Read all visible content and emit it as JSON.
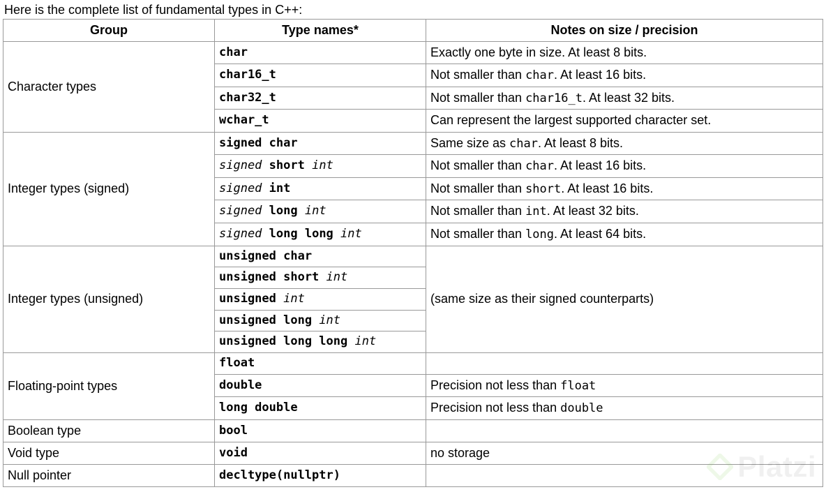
{
  "intro": "Here is the complete list of fundamental types in C++:",
  "headers": {
    "group": "Group",
    "type": "Type names*",
    "notes": "Notes on size / precision"
  },
  "watermark": "Platzi",
  "groups": [
    {
      "name": "Character types",
      "rows": [
        {
          "type_parts": [
            {
              "t": "char",
              "b": true
            }
          ],
          "notes_parts": [
            {
              "t": "Exactly one byte in size. At least 8 bits."
            }
          ]
        },
        {
          "type_parts": [
            {
              "t": "char16_t",
              "b": true
            }
          ],
          "notes_parts": [
            {
              "t": "Not smaller than "
            },
            {
              "t": "char",
              "mono": true
            },
            {
              "t": ". At least 16 bits."
            }
          ]
        },
        {
          "type_parts": [
            {
              "t": "char32_t",
              "b": true
            }
          ],
          "notes_parts": [
            {
              "t": "Not smaller than "
            },
            {
              "t": "char16_t",
              "mono": true
            },
            {
              "t": ". At least 32 bits."
            }
          ]
        },
        {
          "type_parts": [
            {
              "t": "wchar_t",
              "b": true
            }
          ],
          "notes_parts": [
            {
              "t": "Can represent the largest supported character set."
            }
          ]
        }
      ]
    },
    {
      "name": "Integer types (signed)",
      "rows": [
        {
          "type_parts": [
            {
              "t": "signed char",
              "b": true
            }
          ],
          "notes_parts": [
            {
              "t": "Same size as "
            },
            {
              "t": "char",
              "mono": true
            },
            {
              "t": ". At least 8 bits."
            }
          ]
        },
        {
          "type_parts": [
            {
              "t": "signed",
              "i": true
            },
            {
              "t": " "
            },
            {
              "t": "short",
              "b": true
            },
            {
              "t": " "
            },
            {
              "t": "int",
              "i": true
            }
          ],
          "notes_parts": [
            {
              "t": "Not smaller than "
            },
            {
              "t": "char",
              "mono": true
            },
            {
              "t": ". At least 16 bits."
            }
          ]
        },
        {
          "type_parts": [
            {
              "t": "signed",
              "i": true
            },
            {
              "t": " "
            },
            {
              "t": "int",
              "b": true
            }
          ],
          "notes_parts": [
            {
              "t": "Not smaller than "
            },
            {
              "t": "short",
              "mono": true
            },
            {
              "t": ". At least 16 bits."
            }
          ]
        },
        {
          "type_parts": [
            {
              "t": "signed",
              "i": true
            },
            {
              "t": " "
            },
            {
              "t": "long",
              "b": true
            },
            {
              "t": " "
            },
            {
              "t": "int",
              "i": true
            }
          ],
          "notes_parts": [
            {
              "t": "Not smaller than "
            },
            {
              "t": "int",
              "mono": true
            },
            {
              "t": ". At least 32 bits."
            }
          ]
        },
        {
          "type_parts": [
            {
              "t": "signed",
              "i": true
            },
            {
              "t": " "
            },
            {
              "t": "long long",
              "b": true
            },
            {
              "t": " "
            },
            {
              "t": "int",
              "i": true
            }
          ],
          "notes_parts": [
            {
              "t": "Not smaller than "
            },
            {
              "t": "long",
              "mono": true
            },
            {
              "t": ". At least 64 bits."
            }
          ]
        }
      ]
    },
    {
      "name": "Integer types (unsigned)",
      "merged_notes_parts": [
        {
          "t": "(same size as their signed counterparts)"
        }
      ],
      "rows": [
        {
          "type_parts": [
            {
              "t": "unsigned char",
              "b": true
            }
          ]
        },
        {
          "type_parts": [
            {
              "t": "unsigned short",
              "b": true
            },
            {
              "t": " "
            },
            {
              "t": "int",
              "i": true
            }
          ]
        },
        {
          "type_parts": [
            {
              "t": "unsigned",
              "b": true
            },
            {
              "t": " "
            },
            {
              "t": "int",
              "i": true
            }
          ]
        },
        {
          "type_parts": [
            {
              "t": "unsigned long",
              "b": true
            },
            {
              "t": " "
            },
            {
              "t": "int",
              "i": true
            }
          ]
        },
        {
          "type_parts": [
            {
              "t": "unsigned long long",
              "b": true
            },
            {
              "t": " "
            },
            {
              "t": "int",
              "i": true
            }
          ]
        }
      ]
    },
    {
      "name": "Floating-point types",
      "rows": [
        {
          "type_parts": [
            {
              "t": "float",
              "b": true
            }
          ],
          "notes_parts": [
            {
              "t": ""
            }
          ]
        },
        {
          "type_parts": [
            {
              "t": "double",
              "b": true
            }
          ],
          "notes_parts": [
            {
              "t": "Precision not less than "
            },
            {
              "t": "float",
              "mono": true
            }
          ]
        },
        {
          "type_parts": [
            {
              "t": "long double",
              "b": true
            }
          ],
          "notes_parts": [
            {
              "t": "Precision not less than "
            },
            {
              "t": "double",
              "mono": true
            }
          ]
        }
      ]
    },
    {
      "name": "Boolean type",
      "rows": [
        {
          "type_parts": [
            {
              "t": "bool",
              "b": true
            }
          ],
          "notes_parts": [
            {
              "t": ""
            }
          ]
        }
      ]
    },
    {
      "name": "Void type",
      "rows": [
        {
          "type_parts": [
            {
              "t": "void",
              "b": true
            }
          ],
          "notes_parts": [
            {
              "t": "no storage"
            }
          ]
        }
      ]
    },
    {
      "name": "Null pointer",
      "rows": [
        {
          "type_parts": [
            {
              "t": "decltype(nullptr)",
              "b": true
            }
          ],
          "notes_parts": [
            {
              "t": ""
            }
          ]
        }
      ]
    }
  ]
}
